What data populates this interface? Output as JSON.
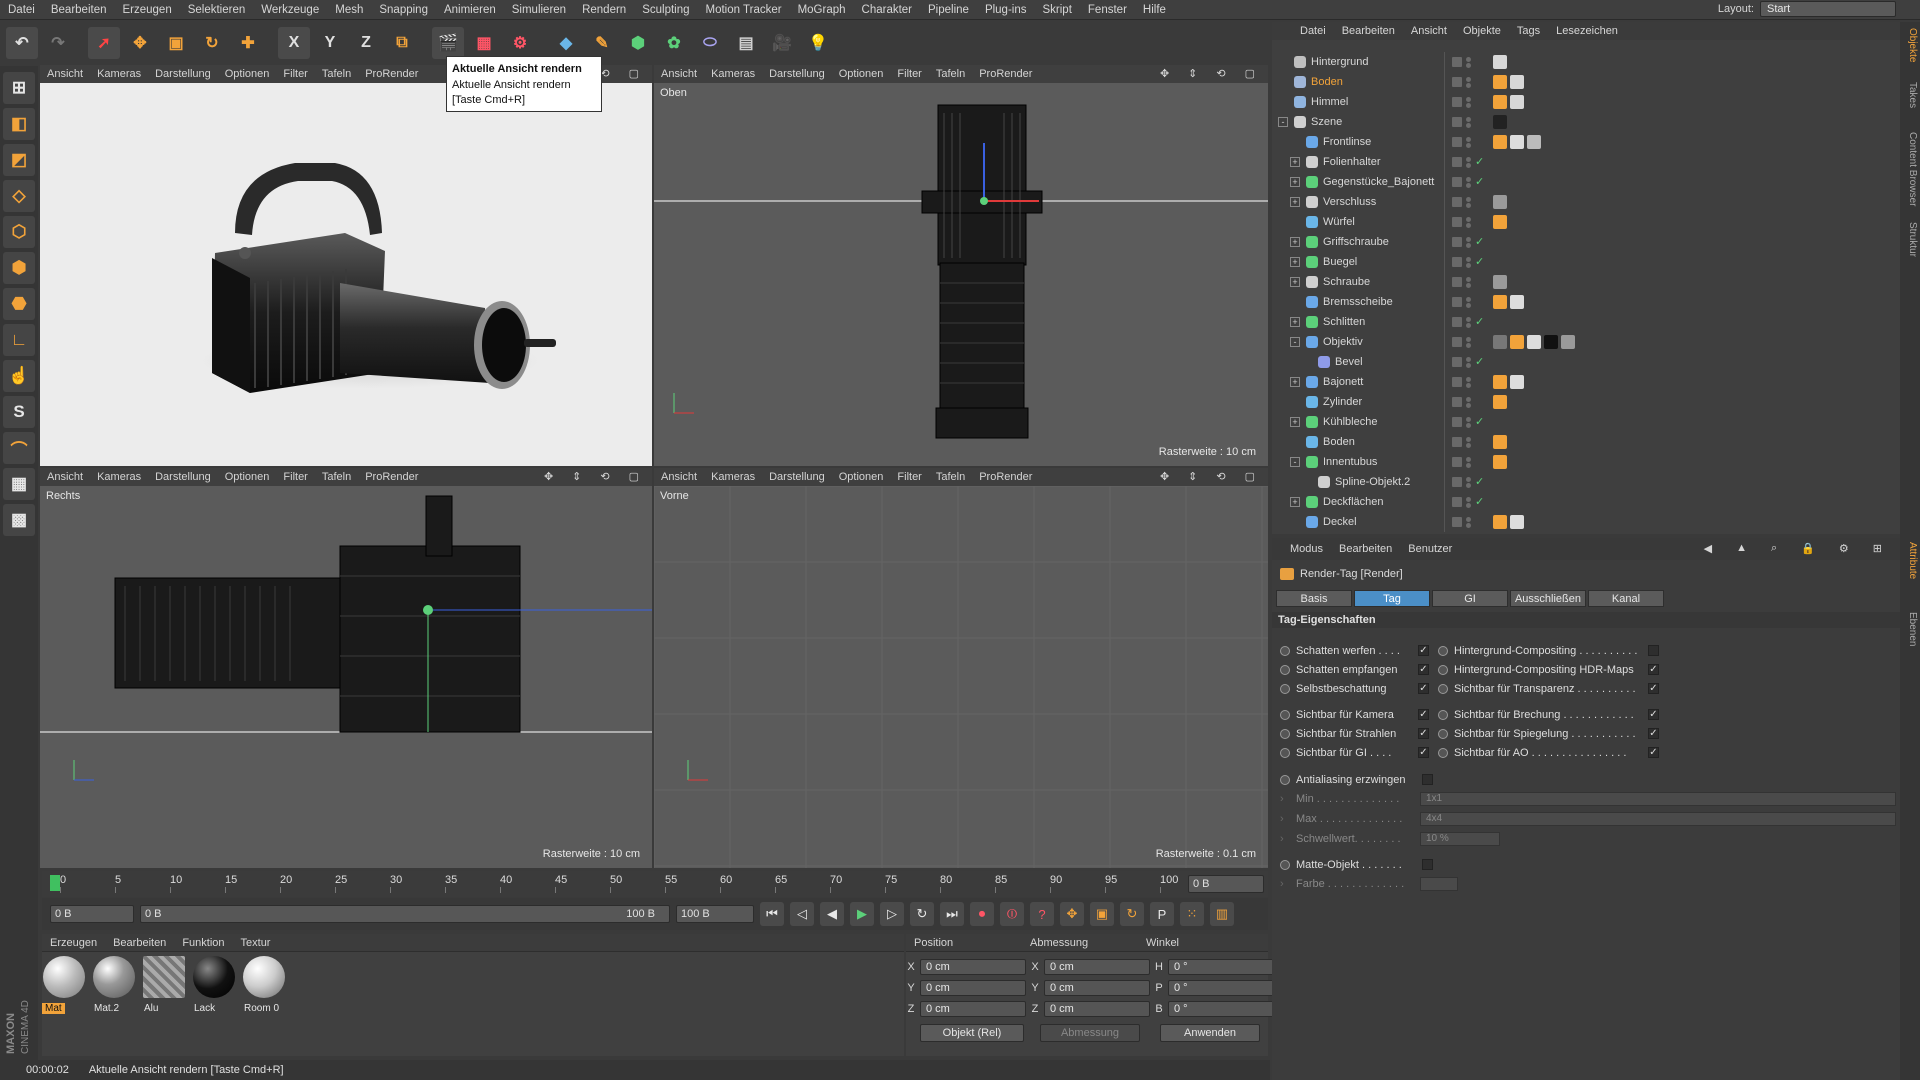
{
  "menu": [
    "Datei",
    "Bearbeiten",
    "Erzeugen",
    "Selektieren",
    "Werkzeuge",
    "Mesh",
    "Snapping",
    "Animieren",
    "Simulieren",
    "Rendern",
    "Sculpting",
    "Motion Tracker",
    "MoGraph",
    "Charakter",
    "Pipeline",
    "Plug-ins",
    "Skript",
    "Fenster",
    "Hilfe"
  ],
  "layout": {
    "label": "Layout:",
    "value": "Start"
  },
  "toolbar": {
    "axis_x": "X",
    "axis_y": "Y",
    "axis_z": "Z"
  },
  "tooltip": {
    "title": "Aktuelle Ansicht rendern",
    "desc": "Aktuelle Ansicht rendern",
    "shortcut": "[Taste Cmd+R]"
  },
  "left_tools": {
    "s_label": "S"
  },
  "viewports": {
    "menu": [
      "Ansicht",
      "Kameras",
      "Darstellung",
      "Optionen",
      "Filter",
      "Tafeln",
      "ProRender"
    ],
    "top": {
      "label": "Oben",
      "raster": "Rasterweite : 10 cm"
    },
    "right": {
      "label": "Rechts",
      "raster": "Rasterweite : 10 cm"
    },
    "front": {
      "label": "Vorne",
      "raster": "Rasterweite : 0.1 cm"
    }
  },
  "timeline": {
    "ticks": [
      "0",
      "5",
      "10",
      "15",
      "20",
      "25",
      "30",
      "35",
      "40",
      "45",
      "50",
      "55",
      "60",
      "65",
      "70",
      "75",
      "80",
      "85",
      "90",
      "95",
      "100"
    ],
    "frame_field": "0 B"
  },
  "transport": {
    "start": "0 B",
    "range_start": "0 B",
    "range_end": "100 B",
    "end": "100 B",
    "key_p": "P"
  },
  "materials": {
    "menu": [
      "Erzeugen",
      "Bearbeiten",
      "Funktion",
      "Textur"
    ],
    "items": [
      "Mat",
      "Mat.2",
      "Alu",
      "Lack",
      "Room 0"
    ]
  },
  "coords": {
    "headers": [
      "Position",
      "Abmessung",
      "Winkel"
    ],
    "rows": [
      {
        "l1": "X",
        "v1": "0 cm",
        "l2": "X",
        "v2": "0 cm",
        "l3": "H",
        "v3": "0 °"
      },
      {
        "l1": "Y",
        "v1": "0 cm",
        "l2": "Y",
        "v2": "0 cm",
        "l3": "P",
        "v3": "0 °"
      },
      {
        "l1": "Z",
        "v1": "0 cm",
        "l2": "Z",
        "v2": "0 cm",
        "l3": "B",
        "v3": "0 °"
      }
    ],
    "mode": "Objekt (Rel)",
    "size_mode": "Abmessung",
    "apply": "Anwenden"
  },
  "status": {
    "time": "00:00:02",
    "message": "Aktuelle Ansicht rendern [Taste Cmd+R]"
  },
  "logo": {
    "brand": "MAXON",
    "product": "CINEMA 4D"
  },
  "object_manager": {
    "menu": [
      "Datei",
      "Bearbeiten",
      "Ansicht",
      "Objekte",
      "Tags",
      "Lesezeichen"
    ],
    "objects": [
      {
        "name": "Hintergrund",
        "level": 0,
        "exp": "",
        "color": "#bfbfbf",
        "tags": [
          "#d8d8d8"
        ]
      },
      {
        "name": "Boden",
        "level": 0,
        "exp": "",
        "color": "#9fb6d9",
        "tags": [
          "#f2a33a",
          "#d8d8d8"
        ],
        "highlight": true
      },
      {
        "name": "Himmel",
        "level": 0,
        "exp": "",
        "color": "#8fb4e0",
        "tags": [
          "#f2a33a",
          "#d8d8d8"
        ]
      },
      {
        "name": "Szene",
        "level": 0,
        "exp": "-",
        "color": "#cfcfcf",
        "tags": [
          "#222222"
        ]
      },
      {
        "name": "Frontlinse",
        "level": 1,
        "exp": "",
        "color": "#6aa8e8",
        "tags": [
          "#f2a33a",
          "#dddddd",
          "#bbbbbb"
        ]
      },
      {
        "name": "Folienhalter",
        "level": 1,
        "exp": "+",
        "color": "#cfcfcf",
        "tags": []
      },
      {
        "name": "Gegenstücke_Bajonett",
        "level": 1,
        "exp": "+",
        "color": "#5cd07a",
        "tags": []
      },
      {
        "name": "Verschluss",
        "level": 1,
        "exp": "+",
        "color": "#cfcfcf",
        "tags": [
          "#9a9a9a"
        ]
      },
      {
        "name": "Würfel",
        "level": 1,
        "exp": "",
        "color": "#6ab6e8",
        "tags": [
          "#f2a33a"
        ]
      },
      {
        "name": "Griffschraube",
        "level": 1,
        "exp": "+",
        "color": "#5cd07a",
        "tags": []
      },
      {
        "name": "Buegel",
        "level": 1,
        "exp": "+",
        "color": "#5cd07a",
        "tags": []
      },
      {
        "name": "Schraube",
        "level": 1,
        "exp": "+",
        "color": "#cfcfcf",
        "tags": [
          "#9a9a9a"
        ]
      },
      {
        "name": "Bremsscheibe",
        "level": 1,
        "exp": "",
        "color": "#6aa8e8",
        "tags": [
          "#f2a33a",
          "#dddddd"
        ]
      },
      {
        "name": "Schlitten",
        "level": 1,
        "exp": "+",
        "color": "#5cd07a",
        "tags": []
      },
      {
        "name": "Objektiv",
        "level": 1,
        "exp": "-",
        "color": "#6aa8e8",
        "tags": [
          "#777777",
          "#f2a33a",
          "#dddddd",
          "#111111",
          "#9a9a9a"
        ]
      },
      {
        "name": "Bevel",
        "level": 2,
        "exp": "",
        "color": "#8f9be8",
        "tags": []
      },
      {
        "name": "Bajonett",
        "level": 1,
        "exp": "+",
        "color": "#6aa8e8",
        "tags": [
          "#f2a33a",
          "#dddddd"
        ]
      },
      {
        "name": "Zylinder",
        "level": 1,
        "exp": "",
        "color": "#6ab6e8",
        "tags": [
          "#f2a33a"
        ]
      },
      {
        "name": "Kühlbleche",
        "level": 1,
        "exp": "+",
        "color": "#5cd07a",
        "tags": []
      },
      {
        "name": "Boden",
        "level": 1,
        "exp": "",
        "color": "#6ab6e8",
        "tags": [
          "#f2a33a"
        ]
      },
      {
        "name": "Innentubus",
        "level": 1,
        "exp": "-",
        "color": "#5cd07a",
        "tags": [
          "#f2a33a"
        ]
      },
      {
        "name": "Spline-Objekt.2",
        "level": 2,
        "exp": "",
        "color": "#cfcfcf",
        "tags": []
      },
      {
        "name": "Deckflächen",
        "level": 1,
        "exp": "+",
        "color": "#5cd07a",
        "tags": []
      },
      {
        "name": "Deckel",
        "level": 1,
        "exp": "",
        "color": "#6aa8e8",
        "tags": [
          "#f2a33a",
          "#dddddd"
        ]
      }
    ]
  },
  "attributes": {
    "menu": [
      "Modus",
      "Bearbeiten",
      "Benutzer"
    ],
    "title": "Render-Tag [Render]",
    "tabs": [
      "Basis",
      "Tag",
      "GI",
      "Ausschließen",
      "Kanal"
    ],
    "active_tab": "Tag",
    "section": "Tag-Eigenschaften",
    "left_props": [
      {
        "label": "Schatten werfen . . . .",
        "checked": true
      },
      {
        "label": "Schatten empfangen",
        "checked": true
      },
      {
        "label": "Selbstbeschattung",
        "checked": true
      },
      {
        "label": "Sichtbar für Kamera",
        "checked": true
      },
      {
        "label": "Sichtbar für Strahlen",
        "checked": true
      },
      {
        "label": "Sichtbar für GI . . . .",
        "checked": true
      }
    ],
    "right_props": [
      {
        "label": "Hintergrund-Compositing . . . . . . . . . .",
        "checked": false
      },
      {
        "label": "Hintergrund-Compositing HDR-Maps",
        "checked": true
      },
      {
        "label": "Sichtbar für Transparenz . . . . . . . . . .",
        "checked": true
      },
      {
        "label": "Sichtbar für Brechung . . . . . . . . . . . .",
        "checked": true
      },
      {
        "label": "Sichtbar für Spiegelung . . . . . . . . . . .",
        "checked": true
      },
      {
        "label": "Sichtbar für AO . . . . . . . . . . . . . . . .",
        "checked": true
      }
    ],
    "antialias": {
      "label": "Antialiasing erzwingen",
      "checked": false
    },
    "aa_fields": [
      {
        "label": "Min . . . . . . . . . . . . . .",
        "value": "1x1"
      },
      {
        "label": "Max . . . . . . . . . . . . . .",
        "value": "4x4"
      },
      {
        "label": "Schwellwert. . . . . . . .",
        "value": "10 %"
      }
    ],
    "matte": {
      "label": "Matte-Objekt . . . . . . .",
      "checked": false
    },
    "farbe": {
      "label": "Farbe . . . . . . . . . . . . ."
    }
  },
  "right_tabs": [
    "Objekte",
    "Takes",
    "Content Browser",
    "Struktur",
    "Attribute",
    "Ebenen"
  ]
}
